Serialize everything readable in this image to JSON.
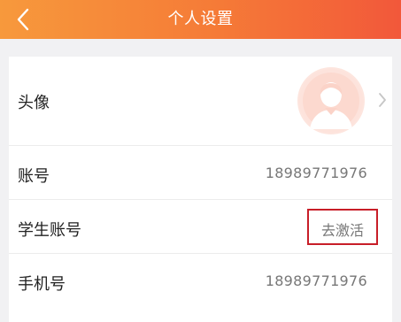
{
  "header": {
    "title": "个人设置",
    "back_icon": "chevron-left-icon",
    "colors": {
      "gradient_start": "#f7993c",
      "gradient_end": "#f2583a"
    }
  },
  "settings": {
    "avatar": {
      "label": "头像",
      "icon": "default-user-avatar",
      "chevron": "chevron-right-icon"
    },
    "account": {
      "label": "账号",
      "value": "18989771976"
    },
    "student_account": {
      "label": "学生账号",
      "action": "去激活",
      "highlight_color": "#c81e28"
    },
    "phone": {
      "label": "手机号",
      "value": "18989771976"
    }
  }
}
